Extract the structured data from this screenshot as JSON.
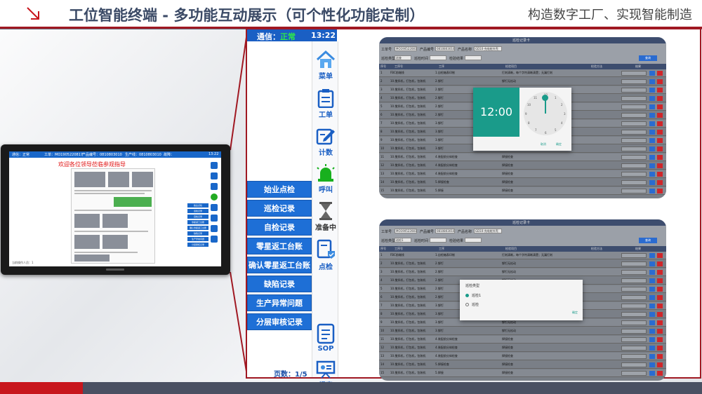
{
  "header": {
    "title": "工位智能终端 - 多功能互动展示（可个性化功能定制）",
    "slogan": "构造数字工厂、实现智能制造"
  },
  "terminal": {
    "status_label": "通信：",
    "status_value": "正常",
    "clock": "13:22",
    "side_buttons": [
      {
        "label": "菜单",
        "icon": "home-icon"
      },
      {
        "label": "工单",
        "icon": "clipboard-icon"
      },
      {
        "label": "计数",
        "icon": "edit-count-icon"
      },
      {
        "label": "呼叫",
        "icon": "alarm-light-icon"
      },
      {
        "label": "准备中",
        "icon": "hourglass-icon"
      },
      {
        "label": "点检",
        "icon": "check-doc-icon"
      },
      {
        "label": "SOP",
        "icon": "sop-doc-icon"
      },
      {
        "label": "报表",
        "icon": "report-board-icon"
      }
    ],
    "menu_items": [
      "始业点检",
      "巡检记录",
      "自检记录",
      "零星返工台账",
      "确认零星返工台账",
      "缺陷记录",
      "生产异常问题",
      "分层审核记录"
    ],
    "pager": "页数：1/5"
  },
  "device": {
    "welcome": "欢迎各位领导莅临参观指导",
    "top_status": [
      "通信：正常",
      "工单：MO1905220817",
      "产品编号：0810803010",
      "生产线：0810803010",
      "故障：",
      "13:22"
    ],
    "menu_items": [
      "始业点检",
      "巡检记录",
      "自检记录",
      "零星返工台账",
      "确认零星返工台账",
      "缺陷记录",
      "生产异常问题",
      "分层审核记录"
    ],
    "footer": "当前操作人员：1"
  },
  "form_shot_1": {
    "title": "巡检记录卡",
    "labels": [
      "工单号",
      "MO1905220817",
      "产品编号",
      "0810803010",
      "产品名称",
      "GD10-充电桩外壳",
      "巡查",
      "巡检类型",
      "巡检时间",
      "检验结果"
    ],
    "headers": [
      "序号",
      "工序号",
      "工序",
      "检验项目",
      "检验方法",
      "结果"
    ],
    "rows": [
      [
        "1",
        "FBC前端线",
        "1.自检箱表印制",
        "打刻清晰，每个字符清晰清楚；无漏打刻"
      ],
      [
        "2",
        "10.搅拌机，打包机，包装机",
        "2.铆钉",
        "铆钉无松动"
      ],
      [
        "3",
        "10.搅拌机，打包机，包装机",
        "2.铆钉",
        "铆钉无松动"
      ],
      [
        "4",
        "10.搅拌机，打包机，包装机",
        "2.铆钉",
        "铆钉无松动"
      ],
      [
        "5",
        "10.搅拌机，打包机，包装机",
        "2.铆钉",
        "铆钉无松动"
      ],
      [
        "6",
        "10.搅拌机，打包机，包装机",
        "2.铆钉",
        "铆钉无松动"
      ],
      [
        "7",
        "10.搅拌机，打包机，包装机",
        "3.铆钉",
        "铆钉无松动"
      ],
      [
        "8",
        "10.搅拌机，打包机，包装机",
        "3.铆钉",
        "铆钉无松动"
      ],
      [
        "9",
        "10.搅拌机，打包机，包装机",
        "3.铆钉",
        "铆钉无松动"
      ],
      [
        "10",
        "10.搅拌机，打包机，包装机",
        "3.铆钉",
        "铆钉无松动"
      ],
      [
        "11",
        "10.搅拌机，打包机，包装机",
        "4.装配前分体检查",
        "焊接检查"
      ],
      [
        "12",
        "10.搅拌机，打包机，包装机",
        "4.装配前分体检查",
        "焊接检查"
      ],
      [
        "13",
        "10.搅拌机，打包机，包装机",
        "4.装配前分体检查",
        "焊接检查"
      ],
      [
        "14",
        "10.搅拌机，打包机，包装机",
        "5.焊接检查",
        "焊接检查"
      ],
      [
        "15",
        "10.搅拌机，打包机，包装机",
        "5.焊接",
        "焊接检查"
      ]
    ],
    "time_dialog": {
      "time": "12:00",
      "cancel": "取消",
      "confirm": "确定"
    },
    "query_btn": "查询"
  },
  "form_shot_2": {
    "title": "巡检记录卡",
    "labels": [
      "工单号",
      "MO1905220817",
      "产品编号",
      "0810803010",
      "产品名称",
      "GD10-充电桩外壳",
      "巡检1",
      "巡检类型",
      "巡检时间",
      "检验结果"
    ],
    "headers": [
      "序号",
      "工序号",
      "工序",
      "检验项目",
      "检验方法",
      "结果"
    ],
    "rows": [
      [
        "1",
        "FBC前端线",
        "1.自检箱表印制",
        "打刻清晰，每个字符清晰清楚；无漏打刻"
      ],
      [
        "2",
        "10.搅拌机，打包机，包装机",
        "2.铆钉",
        "铆钉无松动"
      ],
      [
        "3",
        "10.搅拌机，打包机，包装机",
        "2.铆钉",
        "铆钉无松动"
      ],
      [
        "4",
        "10.搅拌机，打包机，包装机",
        "2.铆钉",
        "铆钉无松动"
      ],
      [
        "5",
        "10.搅拌机，打包机，包装机",
        "2.铆钉",
        "铆钉无松动"
      ],
      [
        "6",
        "10.搅拌机，打包机，包装机",
        "2.铆钉",
        "铆钉无松动"
      ],
      [
        "7",
        "10.搅拌机，打包机，包装机",
        "3.铆钉",
        "铆钉无松动"
      ],
      [
        "8",
        "10.搅拌机，打包机，包装机",
        "3.铆钉",
        "铆钉无松动"
      ],
      [
        "9",
        "10.搅拌机，打包机，包装机",
        "3.铆钉",
        "铆钉无松动"
      ],
      [
        "10",
        "10.搅拌机，打包机，包装机",
        "3.铆钉",
        "铆钉无松动"
      ],
      [
        "11",
        "10.搅拌机，打包机，包装机",
        "4.装配前分体检查",
        "焊接检查"
      ],
      [
        "12",
        "10.搅拌机，打包机，包装机",
        "4.装配前分体检查",
        "焊接检查"
      ],
      [
        "13",
        "10.搅拌机，打包机，包装机",
        "4.装配前分体检查",
        "焊接检查"
      ],
      [
        "14",
        "10.搅拌机，打包机，包装机",
        "5.焊接检查",
        "焊接检查"
      ],
      [
        "15",
        "10.搅拌机，打包机，包装机",
        "5.焊接",
        "焊接检查"
      ]
    ],
    "type_dialog": {
      "title": "巡检类型",
      "options": [
        "巡检1",
        "巡检"
      ],
      "selected": "巡检1",
      "confirm": "确定"
    },
    "query_btn": "查询"
  },
  "colors": {
    "brand_red": "#a01822",
    "primary_blue": "#1e6fd6",
    "status_green": "#2ee84a",
    "dialog_teal": "#1a9b8a"
  }
}
